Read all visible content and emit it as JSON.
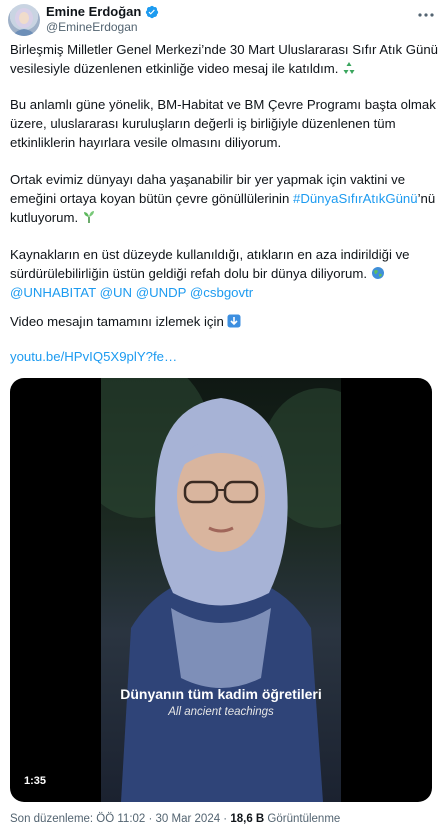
{
  "author": {
    "name": "Emine Erdoğan",
    "handle": "@EmineErdogan"
  },
  "icons": {
    "verified": "verified-badge-icon",
    "more": "more-options-icon",
    "recycle": "recycle-emoji",
    "seedling": "seedling-emoji",
    "globe": "globe-emoji",
    "down_arrow": "down-arrow-emoji"
  },
  "colors": {
    "link": "#1d9bf0",
    "text": "#0f1419",
    "muted": "#536471"
  },
  "tweet": {
    "p1": "Birleşmiş Milletler Genel Merkezi’nde 30 Mart Uluslararası Sıfır Atık Günü vesilesiyle düzenlenen etkinliğe video mesaj ile katıldım.",
    "p2": "Bu anlamlı güne yönelik, BM-Habitat ve BM Çevre Programı başta olmak üzere, uluslararası kuruluşların değerli iş birliğiyle düzenlenen tüm etkinliklerin hayırlara vesile olmasını diliyorum.",
    "p3_before": "Ortak evimiz dünyayı daha yaşanabilir bir yer yapmak için vaktini ve emeğini ortaya koyan bütün çevre gönüllülerinin ",
    "p3_hashtag": "#DünyaSıfırAtıkGünü",
    "p3_after": "’nü kutluyorum.",
    "p4": "Kaynakların en üst düzeyde kullanıldığı, atıkların en aza indirildiği ve sürdürülebilirliğin üstün geldiği refah dolu bir dünya diliyorum.",
    "mentions": [
      "@UNHABITAT",
      "@UN",
      "@UNDP",
      "@csbgovtr"
    ],
    "p5": "Video mesajın tamamını izlemek için",
    "p6_link": "youtu.be/HPvIQ5X9plY?fe…"
  },
  "video": {
    "caption_main": "Dünyanın tüm kadim öğretileri",
    "caption_sub": "All ancient teachings",
    "duration": "1:35"
  },
  "footer": {
    "edited_label": "Son düzenleme: ÖÖ 11:02 · 30 Mar 2024 · ",
    "views_count": "18,6 B",
    "views_label": " Görüntülenme"
  }
}
